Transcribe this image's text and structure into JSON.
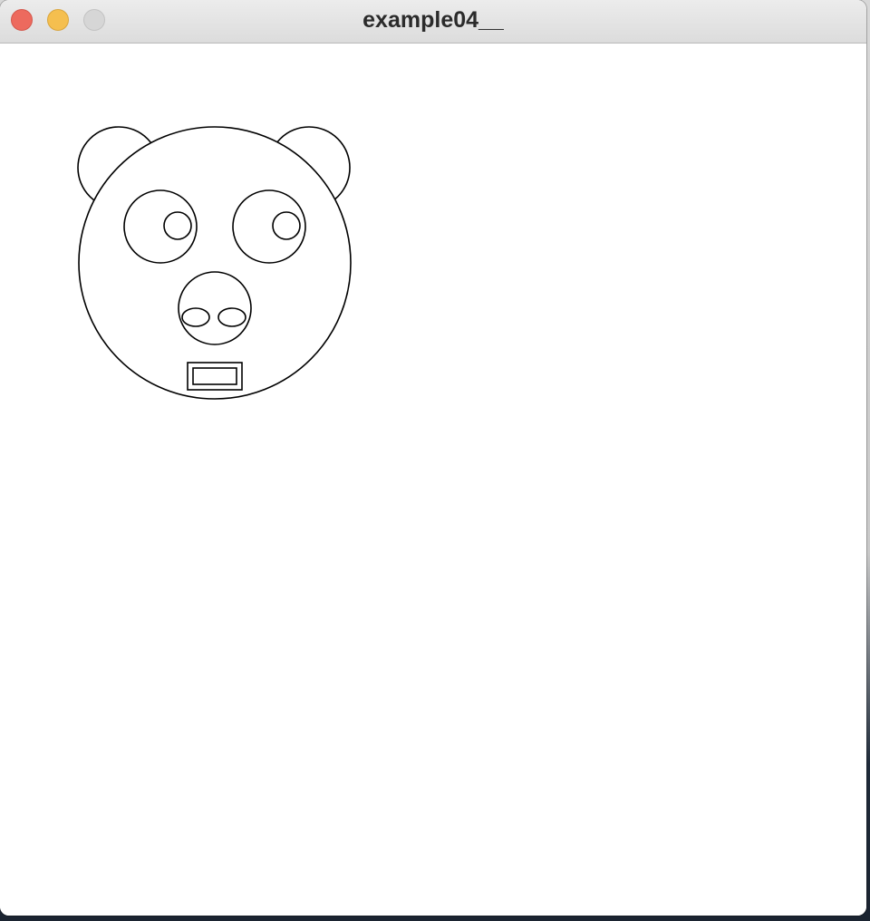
{
  "window": {
    "title": "example04__",
    "controls": {
      "close": {
        "icon": "close-circle-icon",
        "color": "#ed6a5e"
      },
      "minimize": {
        "icon": "minimize-circle-icon",
        "color": "#f5bf4f"
      },
      "zoom": {
        "icon": "zoom-circle-icon",
        "color": "#d6d6d6"
      }
    }
  },
  "canvas": {
    "background": "#ffffff",
    "stroke_color": "#000000",
    "fill_color": "#ffffff",
    "drawing": "bear-face-icon"
  }
}
